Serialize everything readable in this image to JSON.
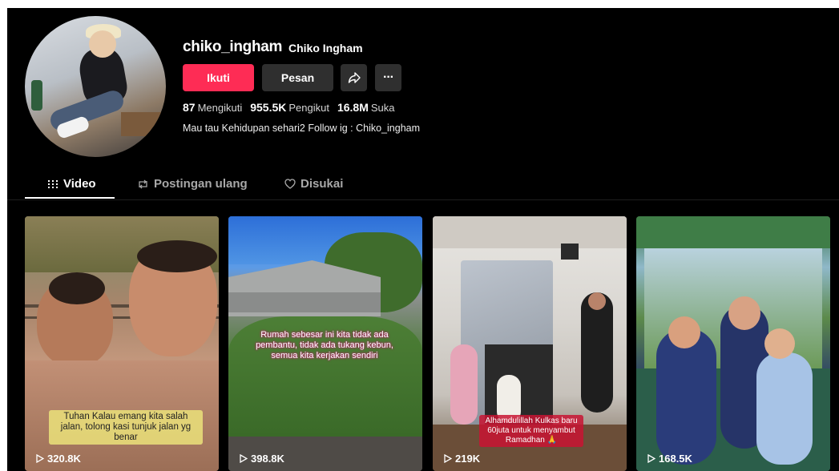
{
  "profile": {
    "username": "chiko_ingham",
    "nickname": "Chiko Ingham",
    "bio": "Mau tau Kehidupan sehari2 Follow ig : Chiko_ingham",
    "stats": [
      {
        "value": "87",
        "label": "Mengikuti"
      },
      {
        "value": "955.5K",
        "label": "Pengikut"
      },
      {
        "value": "16.8M",
        "label": "Suka"
      }
    ]
  },
  "actions": {
    "follow": "Ikuti",
    "message": "Pesan",
    "share_icon": "share-icon",
    "more_icon": "more-icon",
    "more_glyph": "···"
  },
  "tabs": [
    {
      "label": "Video",
      "icon": "grid-icon",
      "active": true
    },
    {
      "label": "Postingan ulang",
      "icon": "repost-icon",
      "active": false
    },
    {
      "label": "Disukai",
      "icon": "heart-icon",
      "active": false
    }
  ],
  "videos": [
    {
      "views": "320.8K",
      "caption": "Tuhan Kalau emang kita salah jalan, tolong kasi tunjuk jalan yg benar"
    },
    {
      "views": "398.8K",
      "caption": "Rumah sebesar ini kita tidak ada pembantu, tidak ada tukang kebun, semua kita kerjakan sendiri"
    },
    {
      "views": "219K",
      "caption": "Alhamdulillah Kulkas baru 60juta untuk menyambut Ramadhan 🙏"
    },
    {
      "views": "168.5K",
      "caption": ""
    }
  ],
  "colors": {
    "accent": "#fe2c55",
    "background": "#000000",
    "button_dark": "#2f2f2f"
  }
}
